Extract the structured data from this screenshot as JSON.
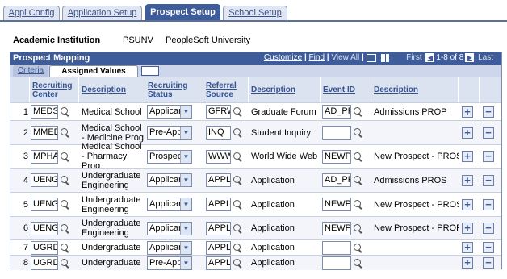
{
  "tabs": {
    "appl_config": "Appl Config",
    "application_setup": "Application Setup",
    "prospect_setup": "Prospect Setup",
    "school_setup": "School Setup"
  },
  "institution": {
    "label": "Academic Institution",
    "code": "PSUNV",
    "name": "PeopleSoft University"
  },
  "grid": {
    "title": "Prospect Mapping",
    "customize": "Customize",
    "find": "Find",
    "view_all": "View All",
    "separator": "|",
    "first": "First",
    "range": "1-8 of 8",
    "last": "Last",
    "tab_criteria": "Criteria",
    "tab_assigned": "Assigned Values"
  },
  "columns": {
    "recruiting_center": "Recruiting Center",
    "description1": "Description",
    "recruiting_status": "Recruiting Status",
    "referral_source": "Referral Source",
    "description2": "Description",
    "event_id": "Event ID",
    "description3": "Description"
  },
  "rows": [
    {
      "num": "1",
      "center": "MEDS",
      "desc1": "Medical School",
      "status": "Applicar",
      "referral": "GFRW",
      "desc2": "Graduate Forum",
      "event": "AD_PR",
      "desc3": "Admissions PROP"
    },
    {
      "num": "2",
      "center": "MMED",
      "desc1": "Medical School - Medicine Prog",
      "status": "Pre-App",
      "referral": "INQ",
      "desc2": "Student Inquiry",
      "event": "",
      "desc3": ""
    },
    {
      "num": "3",
      "center": "MPHA",
      "desc1": "Medical School - Pharmacy Prog",
      "status": "Prospec",
      "referral": "WWW",
      "desc2": "World Wide Web",
      "event": "NEWPI",
      "desc3": "New Prospect - PROS"
    },
    {
      "num": "4",
      "center": "UENG",
      "desc1": "Undergraduate Engineering",
      "status": "Applicar",
      "referral": "APPL",
      "desc2": "Application",
      "event": "AD_PR",
      "desc3": "Admissions PROS"
    },
    {
      "num": "5",
      "center": "UENG",
      "desc1": "Undergraduate Engineering",
      "status": "Applicar",
      "referral": "APPL",
      "desc2": "Application",
      "event": "NEWPI",
      "desc3": "New Prospect - PROS"
    },
    {
      "num": "6",
      "center": "UENG",
      "desc1": "Undergraduate Engineering",
      "status": "Applicar",
      "referral": "APPL",
      "desc2": "Application",
      "event": "NEWPI",
      "desc3": "New Prospect - PROP"
    },
    {
      "num": "7",
      "center": "UGRD",
      "desc1": "Undergraduate",
      "status": "Applicar",
      "referral": "APPL",
      "desc2": "Application",
      "event": "",
      "desc3": ""
    },
    {
      "num": "8",
      "center": "UGRD",
      "desc1": "Undergraduate",
      "status": "Pre-App",
      "referral": "APPL",
      "desc2": "Application",
      "event": "",
      "desc3": ""
    }
  ],
  "icons": {
    "lookup": "magnifier-icon",
    "add": "+",
    "delete": "−",
    "dropdown": "▼"
  },
  "colors": {
    "header": "#3e5c99",
    "link": "#36528e",
    "tab_bg": "#e2e6f0"
  }
}
